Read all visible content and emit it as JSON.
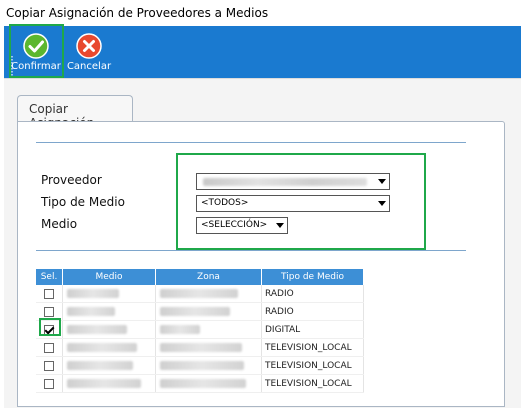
{
  "window": {
    "title": "Copiar Asignación de Proveedores a Medios"
  },
  "toolbar": {
    "confirm_label": "Confirmar",
    "cancel_label": "Cancelar"
  },
  "tab": {
    "label": "Copiar Asignación"
  },
  "form": {
    "proveedor_label": "Proveedor",
    "tipo_medio_label": "Tipo de Medio",
    "tipo_medio_value": "<TODOS>",
    "medio_label": "Medio",
    "medio_value": "<SELECCIÓN>"
  },
  "grid": {
    "headers": [
      "Sel.",
      "Medio",
      "Zona",
      "Tipo de Medio"
    ],
    "rows": [
      {
        "checked": false,
        "tipo": "RADIO"
      },
      {
        "checked": false,
        "tipo": "RADIO"
      },
      {
        "checked": true,
        "tipo": "DIGITAL"
      },
      {
        "checked": false,
        "tipo": "TELEVISION_LOCAL"
      },
      {
        "checked": false,
        "tipo": "TELEVISION_LOCAL"
      },
      {
        "checked": false,
        "tipo": "TELEVISION_LOCAL"
      }
    ]
  },
  "colors": {
    "toolbar": "#1a7ad0",
    "grid_header": "#3d8fd6",
    "highlight": "#1fa84a",
    "confirm_icon": "#5cb72f",
    "cancel_icon": "#e8492f"
  }
}
